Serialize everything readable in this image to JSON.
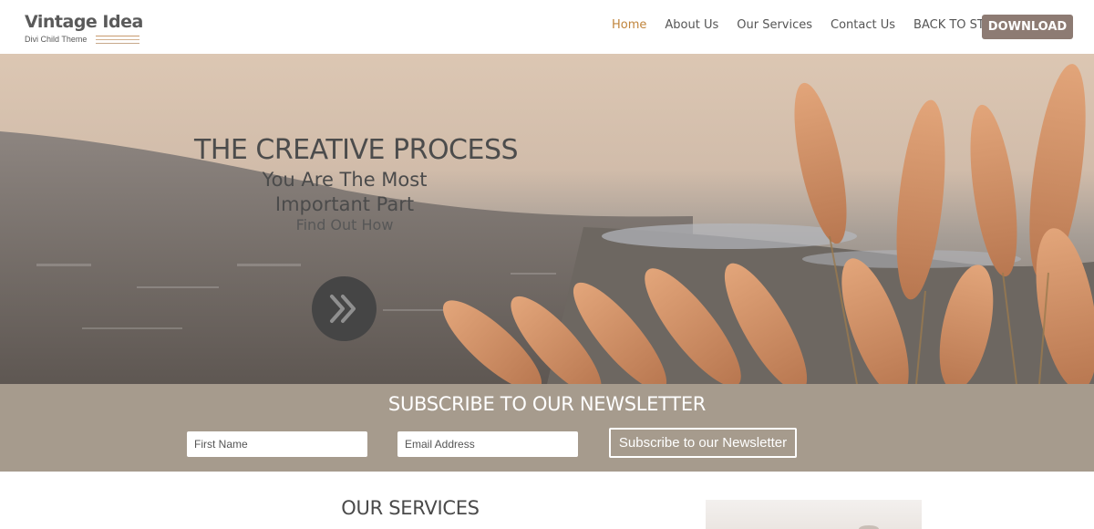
{
  "logo": {
    "title": "Vintage Idea",
    "subtitle": "Divi Child Theme"
  },
  "nav": {
    "items": [
      {
        "label": "Home",
        "active": true
      },
      {
        "label": "About Us",
        "active": false
      },
      {
        "label": "Our Services",
        "active": false
      },
      {
        "label": "Contact Us",
        "active": false
      },
      {
        "label": "BACK TO STORE",
        "active": false
      }
    ],
    "download_label": "DOWNLOAD"
  },
  "hero": {
    "title": "THE CREATIVE PROCESS",
    "subtitle_line1": "You Are The Most",
    "subtitle_line2": "Important Part",
    "link_text": "Find Out How",
    "icon": "double-chevron-right-icon"
  },
  "newsletter": {
    "title": "SUBSCRIBE TO OUR NEWSLETTER",
    "first_name_placeholder": "First Name",
    "email_placeholder": "Email Address",
    "button_label": "Subscribe to our Newsletter"
  },
  "services": {
    "title": "OUR SERVICES"
  },
  "colors": {
    "accent": "#c0843c",
    "button_bg": "#8d7b73",
    "newsletter_bg": "#a69b8d",
    "hero_circle": "#454545"
  }
}
